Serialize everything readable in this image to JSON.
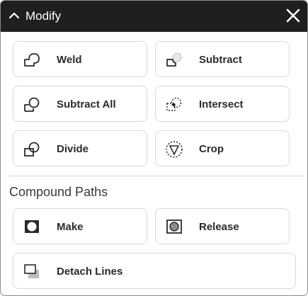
{
  "panel": {
    "title": "Modify"
  },
  "buttons": {
    "weld": "Weld",
    "subtract": "Subtract",
    "subtract_all": "Subtract All",
    "intersect": "Intersect",
    "divide": "Divide",
    "crop": "Crop"
  },
  "compound_paths": {
    "heading": "Compound Paths",
    "make": "Make",
    "release": "Release",
    "detach_lines": "Detach Lines"
  },
  "icons": {
    "collapse": "chevron-up-icon",
    "close": "close-icon",
    "weld": "weld-icon",
    "subtract": "subtract-icon",
    "subtract_all": "subtract-all-icon",
    "intersect": "intersect-icon",
    "divide": "divide-icon",
    "crop": "crop-icon",
    "make": "make-compound-icon",
    "release": "release-compound-icon",
    "detach_lines": "detach-lines-icon"
  },
  "colors": {
    "titlebar": "#1f1f1f",
    "title_text": "#ffffff",
    "button_border": "#d9d9d9",
    "label_text": "#2b2b2b"
  }
}
